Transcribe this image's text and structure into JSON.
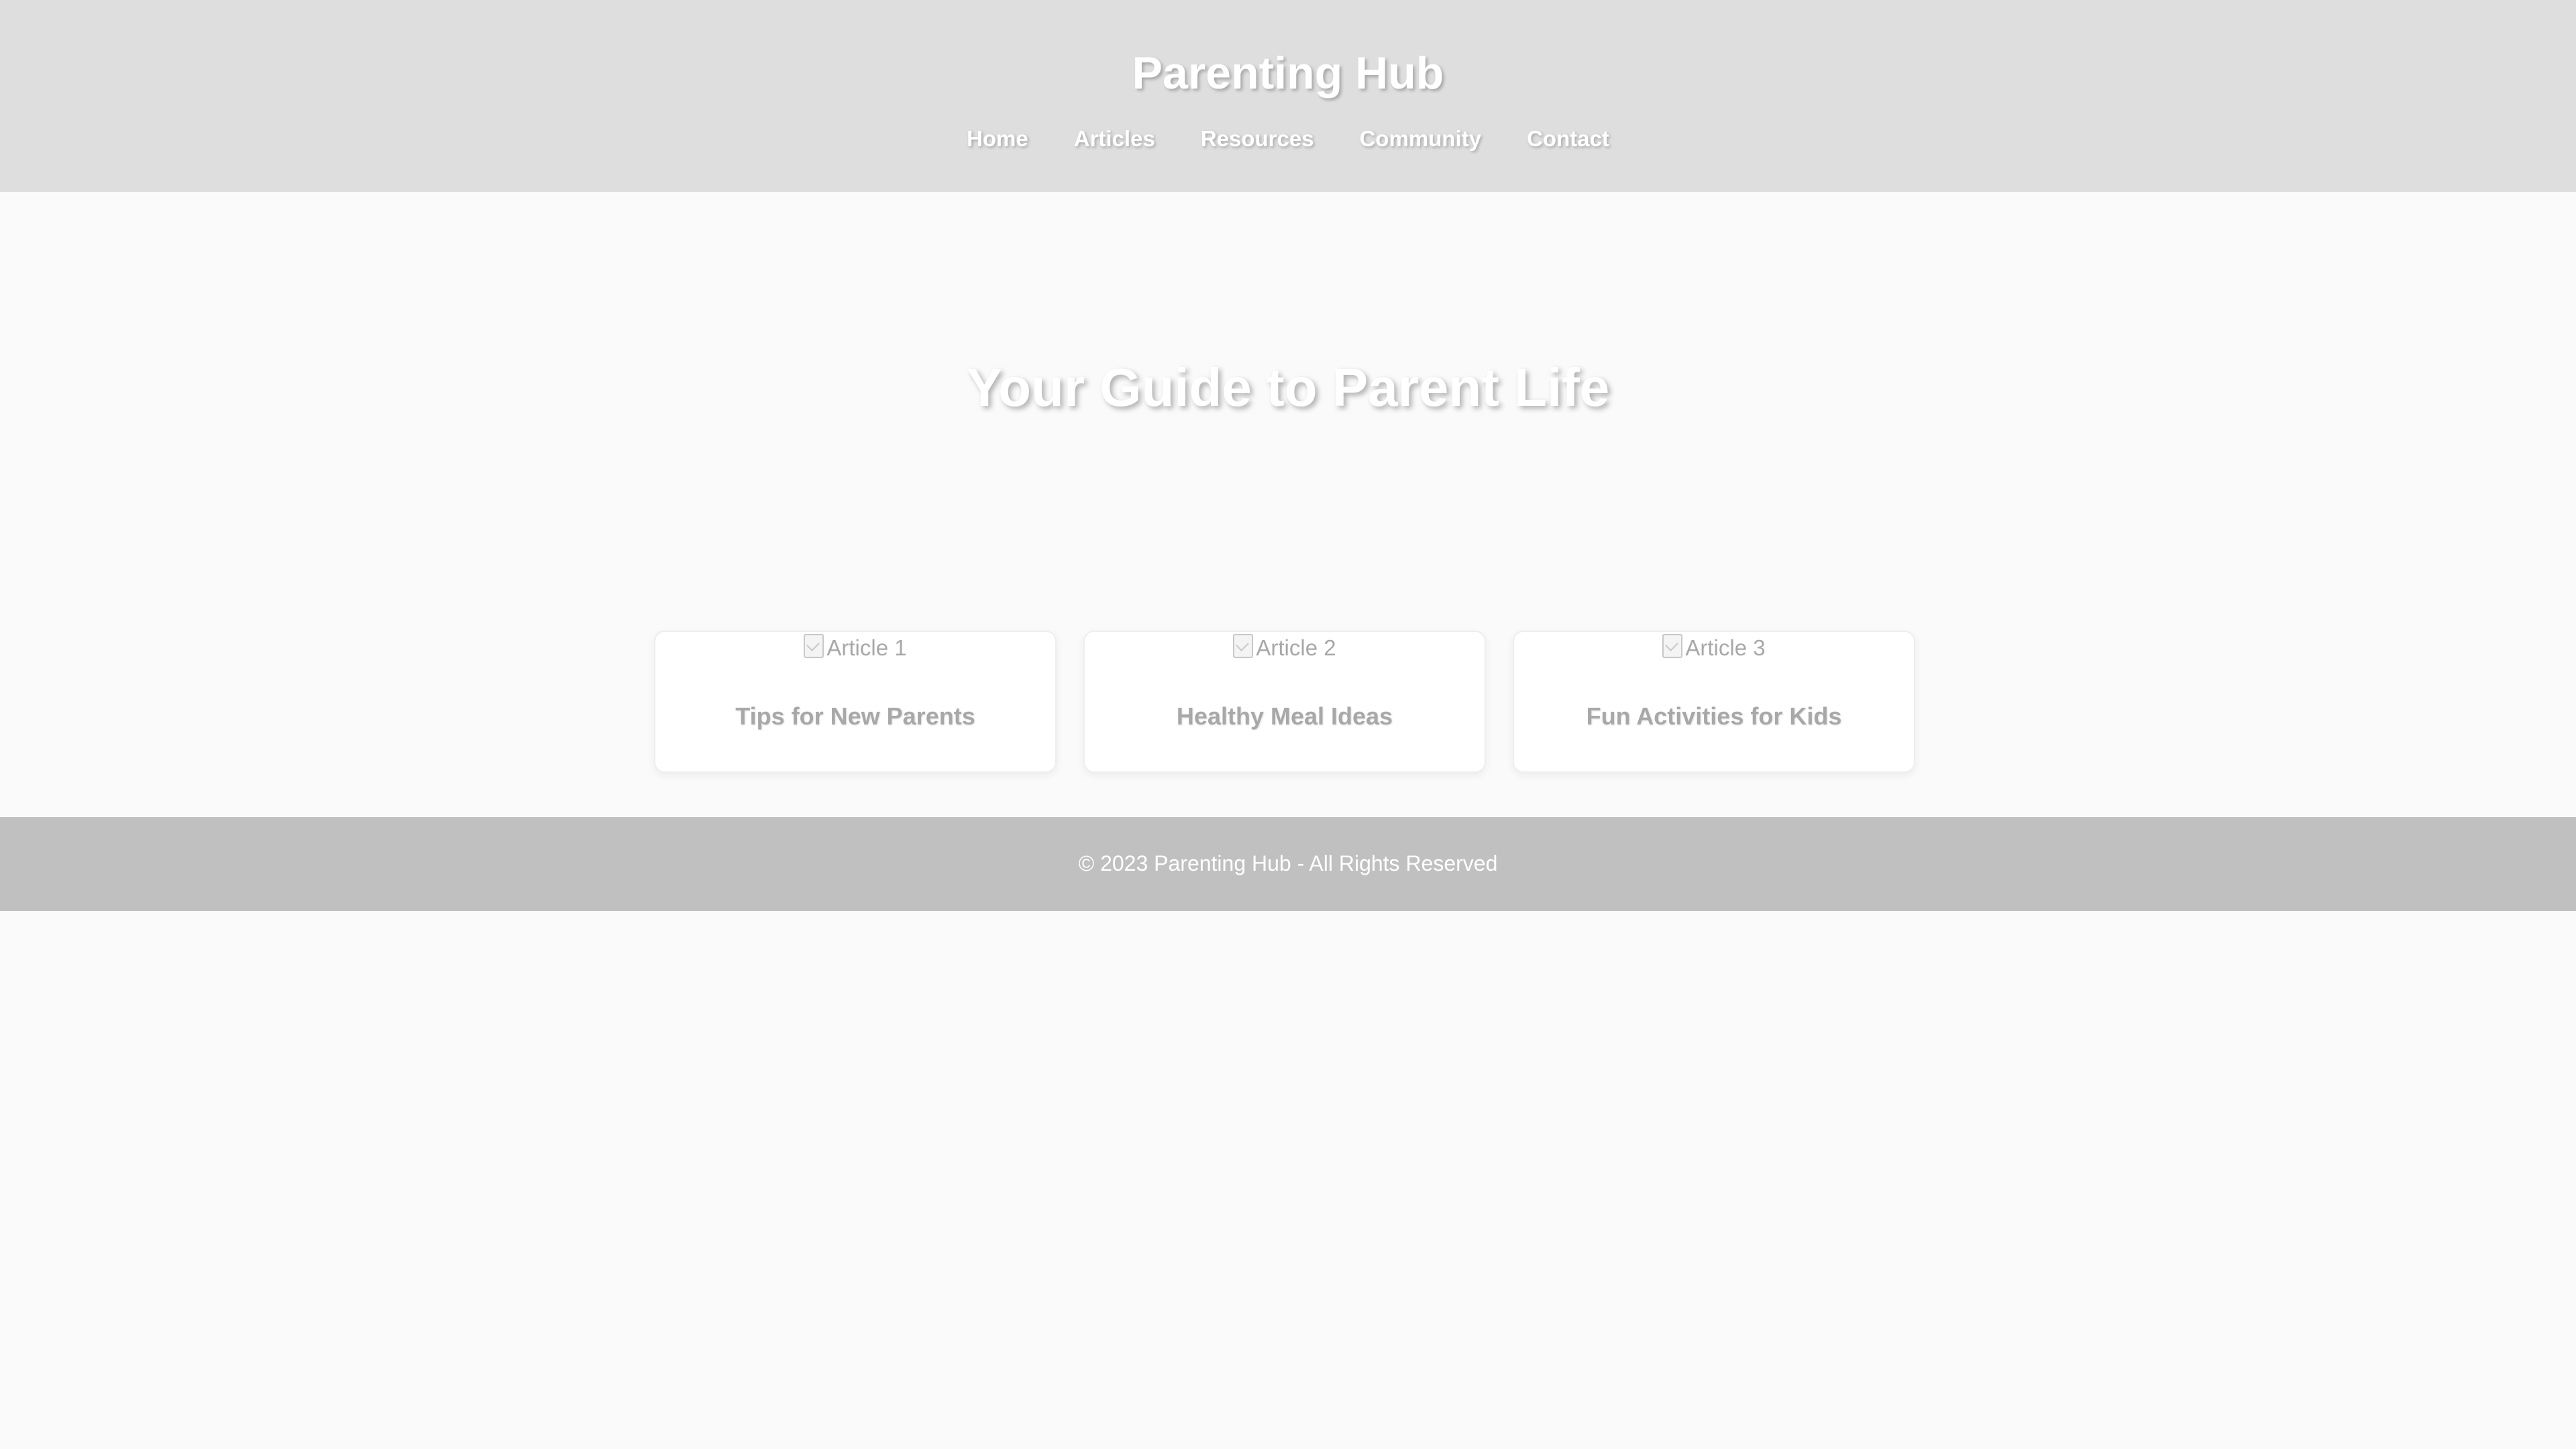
{
  "header": {
    "title": "Parenting Hub",
    "nav": [
      {
        "label": "Home"
      },
      {
        "label": "Articles"
      },
      {
        "label": "Resources"
      },
      {
        "label": "Community"
      },
      {
        "label": "Contact"
      }
    ]
  },
  "hero": {
    "title": "Your Guide to Parent Life"
  },
  "articles": [
    {
      "image_alt": "Article 1",
      "title": "Tips for New Parents"
    },
    {
      "image_alt": "Article 2",
      "title": "Healthy Meal Ideas"
    },
    {
      "image_alt": "Article 3",
      "title": "Fun Activities for Kids"
    }
  ],
  "footer": {
    "text": "© 2023 Parenting Hub - All Rights Reserved"
  },
  "colors": {
    "header_bg": "#dedede",
    "page_bg": "#fafafa",
    "footer_bg": "#c0c0c0",
    "card_text": "#a8a8a8"
  },
  "icons": {
    "card_image": "broken-image-icon"
  }
}
